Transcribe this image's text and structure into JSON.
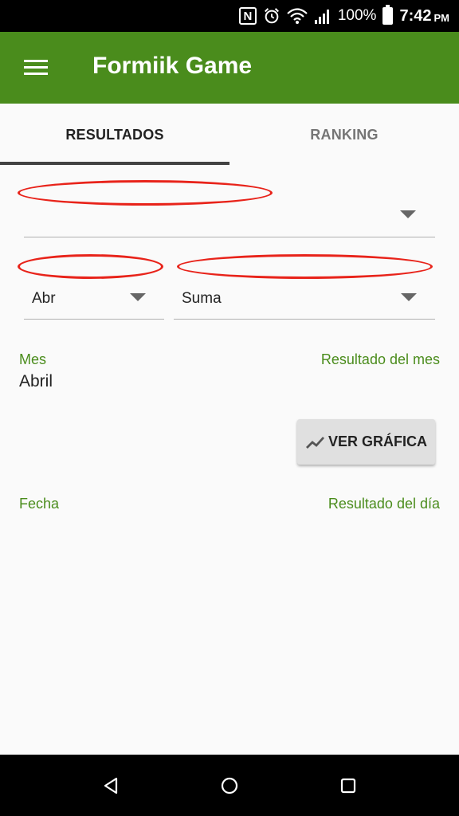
{
  "status_bar": {
    "nfc_label": "N",
    "battery_percent": "100%",
    "time": "7:42",
    "ampm": "PM",
    "icons": [
      "nfc-icon",
      "alarm-icon",
      "wifi-icon",
      "signal-icon",
      "battery-icon"
    ]
  },
  "app_bar": {
    "title": "Formiik Game",
    "background_color": "#4a8c1c"
  },
  "tabs": [
    {
      "label": "RESULTADOS",
      "selected": true
    },
    {
      "label": "RANKING",
      "selected": false
    }
  ],
  "form": {
    "month_selector": {
      "value": "Abr"
    },
    "operation_selector": {
      "value": "Suma"
    }
  },
  "month_section": {
    "month_label": "Mes",
    "month_value": "Abril",
    "result_label": "Resultado del mes"
  },
  "chart_button": {
    "label": "VER GRÁFICA",
    "icon": "trending-up-icon"
  },
  "daily_section": {
    "date_label": "Fecha",
    "result_label": "Resultado del día"
  },
  "nav_bar": {
    "icons": [
      "back-icon",
      "home-icon",
      "recents-icon"
    ]
  },
  "colors": {
    "accent": "#4a8c1c",
    "annotation": "#e8231a"
  }
}
